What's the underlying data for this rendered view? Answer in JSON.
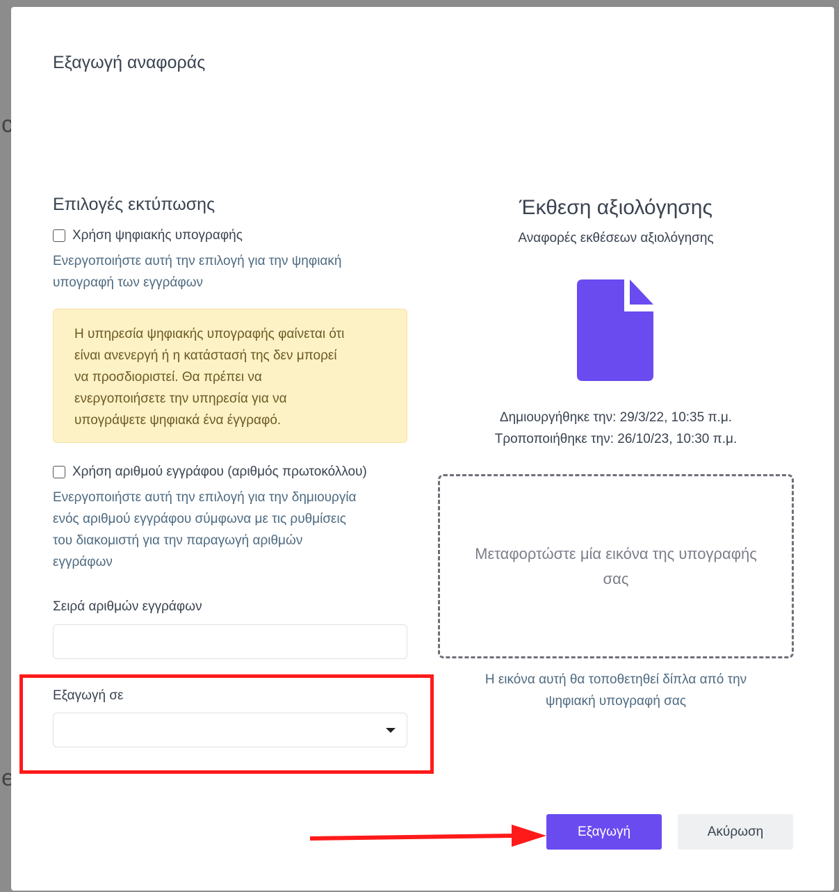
{
  "dialog": {
    "title": "Εξαγωγή αναφοράς"
  },
  "print_options": {
    "heading": "Επιλογές εκτύπωσης",
    "digital_signature": {
      "label": "Χρήση ψηφιακής υπογραφής",
      "help_line1": "Ενεργοποιήστε αυτή την επιλογή για την ψηφιακή",
      "help_line2": "υπογραφή των εγγράφων",
      "checked": false
    },
    "alert": {
      "line1": "Η υπηρεσία ψηφιακής υπογραφής φαίνεται ότι",
      "line2": "είναι ανενεργή ή η κατάστασή της δεν μπορεί",
      "line3": "να προσδιοριστεί. Θα πρέπει να",
      "line4": "ενεργοποιήσετε την υπηρεσία για να",
      "line5": "υπογράψετε ψηφιακά ένα έγγραφό."
    },
    "document_number": {
      "label": "Χρήση αριθμού εγγράφου (αριθμός πρωτοκόλλου)",
      "help_line1": "Ενεργοποιήστε αυτή την επιλογή για την δημιουργία",
      "help_line2": "ενός αριθμού εγγράφου σύμφωνα με τις ρυθμίσεις",
      "help_line3": "του διακομιστή για την παραγωγή αριθμών",
      "help_line4": "εγγράφων",
      "checked": false
    },
    "number_series": {
      "label": "Σειρά αριθμών εγγράφων",
      "value": ""
    },
    "export_to": {
      "label": "Εξαγωγή σε",
      "value": ""
    }
  },
  "report": {
    "title": "Έκθεση αξιολόγησης",
    "subtitle": "Αναφορές εκθέσεων αξιολόγησης",
    "created": "Δημιουργήθηκε την: 29/3/22, 10:35 π.μ.",
    "modified": "Τροποποιήθηκε την: 26/10/23, 10:30 π.μ.",
    "icon": "file-icon",
    "icon_color": "#6a4bf0"
  },
  "upload": {
    "line1": "Μεταφορτώστε μία εικόνα της υπογραφής",
    "line2": "σας",
    "hint_line1": "Η εικόνα αυτή θα τοποθετηθεί δίπλα από την",
    "hint_line2": "ψηφιακή υπογραφή σας"
  },
  "actions": {
    "export_label": "Εξαγωγή",
    "cancel_label": "Ακύρωση"
  },
  "colors": {
    "primary": "#6a4bf0",
    "annotation": "#ff1a1a",
    "alert_bg": "#fdf1c6"
  }
}
